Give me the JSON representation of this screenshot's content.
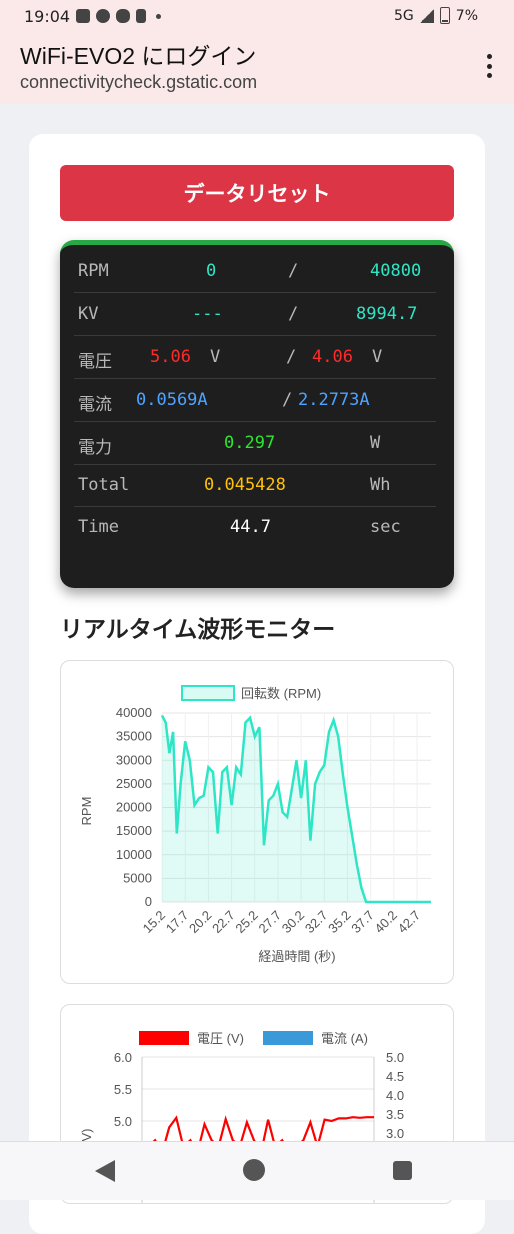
{
  "status_bar": {
    "time": "19:04",
    "network": "5G",
    "battery": "7%",
    "icons": [
      "alert-icon",
      "line-icon",
      "chat-icon",
      "accessibility-icon",
      "dot-icon"
    ]
  },
  "browser": {
    "title": "WiFi-EVO2 にログイン",
    "url": "connectivitycheck.gstatic.com"
  },
  "reset_button": "データリセット",
  "monitor": {
    "rpm": {
      "label": "RPM",
      "current": "0",
      "sep": "/",
      "max": "40800"
    },
    "kv": {
      "label": "KV",
      "current": "---",
      "sep": "/",
      "max": "8994.7"
    },
    "voltage": {
      "label": "電圧",
      "current": "5.06",
      "unit1": "V",
      "sep": "/",
      "min": "4.06",
      "unit2": "V"
    },
    "current": {
      "label": "電流",
      "current": "0.0569A",
      "sep": "/",
      "max": "2.2773A"
    },
    "power": {
      "label": "電力",
      "value": "0.297",
      "unit": "W"
    },
    "total": {
      "label": "Total",
      "value": "0.045428",
      "unit": "Wh"
    },
    "time": {
      "label": "Time",
      "value": "44.7",
      "unit": "sec"
    }
  },
  "section_title": "リアルタイム波形モニター",
  "colors": {
    "accent_red": "#dc3545",
    "monitor_green": "#28a745",
    "rpm_line": "#2ee6c5",
    "voltage_line": "#ff0000",
    "current_line": "#3a9ad9"
  },
  "chart_data": [
    {
      "type": "area",
      "legend": "回転数 (RPM)",
      "xlabel": "経過時間 (秒)",
      "ylabel": "RPM",
      "ylim": [
        0,
        40000
      ],
      "y_ticks": [
        "0",
        "5000",
        "10000",
        "15000",
        "20000",
        "25000",
        "30000",
        "35000",
        "40000"
      ],
      "x_ticks": [
        "15.2",
        "17.7",
        "20.2",
        "22.7",
        "25.2",
        "27.7",
        "30.2",
        "32.7",
        "35.2",
        "37.7",
        "40.2",
        "42.7"
      ],
      "x": [
        15.2,
        15.6,
        16.0,
        16.4,
        16.8,
        17.2,
        17.7,
        18.2,
        18.7,
        19.2,
        19.7,
        20.2,
        20.7,
        21.2,
        21.7,
        22.2,
        22.7,
        23.2,
        23.7,
        24.2,
        24.7,
        25.2,
        25.7,
        26.2,
        26.7,
        27.2,
        27.7,
        28.2,
        28.7,
        29.2,
        29.7,
        30.2,
        30.7,
        31.2,
        31.7,
        32.2,
        32.7,
        33.2,
        33.7,
        34.2,
        34.7,
        35.2,
        35.7,
        36.2,
        36.7,
        37.2,
        37.7,
        38.2,
        38.7,
        39.2,
        39.7,
        40.2,
        40.7,
        41.2,
        41.7,
        42.2,
        42.7,
        43.2,
        43.7,
        44.2
      ],
      "values": [
        39500,
        38000,
        31500,
        36000,
        14500,
        25000,
        34000,
        30000,
        20500,
        22000,
        22500,
        28500,
        27500,
        14500,
        27500,
        28500,
        20500,
        28500,
        27000,
        38000,
        39000,
        35000,
        37000,
        12000,
        21500,
        22500,
        25000,
        19000,
        18000,
        24000,
        30000,
        22000,
        30000,
        13000,
        25000,
        27500,
        29000,
        36000,
        38500,
        35000,
        27000,
        20000,
        14000,
        8000,
        3000,
        0,
        0,
        0,
        0,
        0,
        0,
        0,
        0,
        0,
        0,
        0,
        0,
        0,
        0,
        0
      ]
    },
    {
      "type": "line",
      "series": [
        {
          "name": "電圧 (V)",
          "axis": "left"
        },
        {
          "name": "電流 (A)",
          "axis": "right"
        }
      ],
      "left_ticks": [
        "5.0",
        "5.5",
        "6.0"
      ],
      "right_ticks": [
        "3.0",
        "3.5",
        "4.0",
        "4.5",
        "5.0"
      ],
      "voltage_values": [
        4.6,
        4.7,
        4.5,
        4.9,
        5.05,
        4.6,
        4.7,
        4.5,
        4.95,
        4.7,
        4.6,
        5.03,
        4.7,
        4.6,
        4.98,
        4.7,
        4.5,
        5.02,
        4.6,
        4.7,
        4.5,
        4.6,
        4.7,
        4.98,
        4.6,
        5.02,
        5.0,
        5.04,
        5.04,
        5.06,
        5.05,
        5.06,
        5.06
      ]
    }
  ]
}
